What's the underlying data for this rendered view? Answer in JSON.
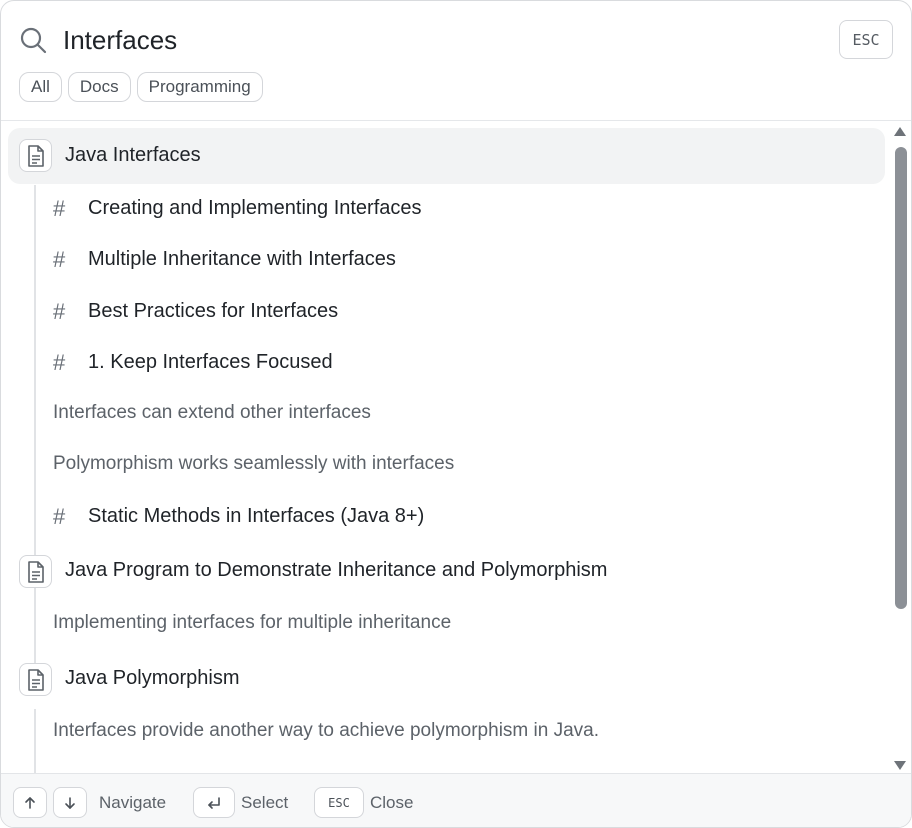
{
  "search": {
    "value": "Interfaces",
    "esc_label": "ESC"
  },
  "filters": [
    "All",
    "Docs",
    "Programming"
  ],
  "results": {
    "doc1": {
      "title": "Java Interfaces",
      "headings": [
        "Creating and Implementing Interfaces",
        "Multiple Inheritance with Interfaces",
        "Best Practices for Interfaces",
        "1. Keep Interfaces Focused"
      ],
      "snippets": [
        "Interfaces can extend other interfaces",
        "Polymorphism works seamlessly with interfaces"
      ],
      "last_heading": "Static Methods in Interfaces (Java 8+)"
    },
    "doc2": {
      "title": "Java Program to Demonstrate Inheritance and Polymorphism",
      "snippet": "Implementing interfaces for multiple inheritance"
    },
    "doc3": {
      "title": "Java Polymorphism",
      "snippet": "Interfaces provide another way to achieve polymorphism in Java."
    }
  },
  "footer": {
    "navigate_label": "Navigate",
    "select_label": "Select",
    "esc_key": "ESC",
    "close_label": "Close"
  },
  "icons": {
    "search": "search-icon",
    "doc": "document-icon",
    "heading": "hash-icon",
    "up": "arrow-up-icon",
    "down": "arrow-down-icon",
    "enter": "enter-icon"
  }
}
